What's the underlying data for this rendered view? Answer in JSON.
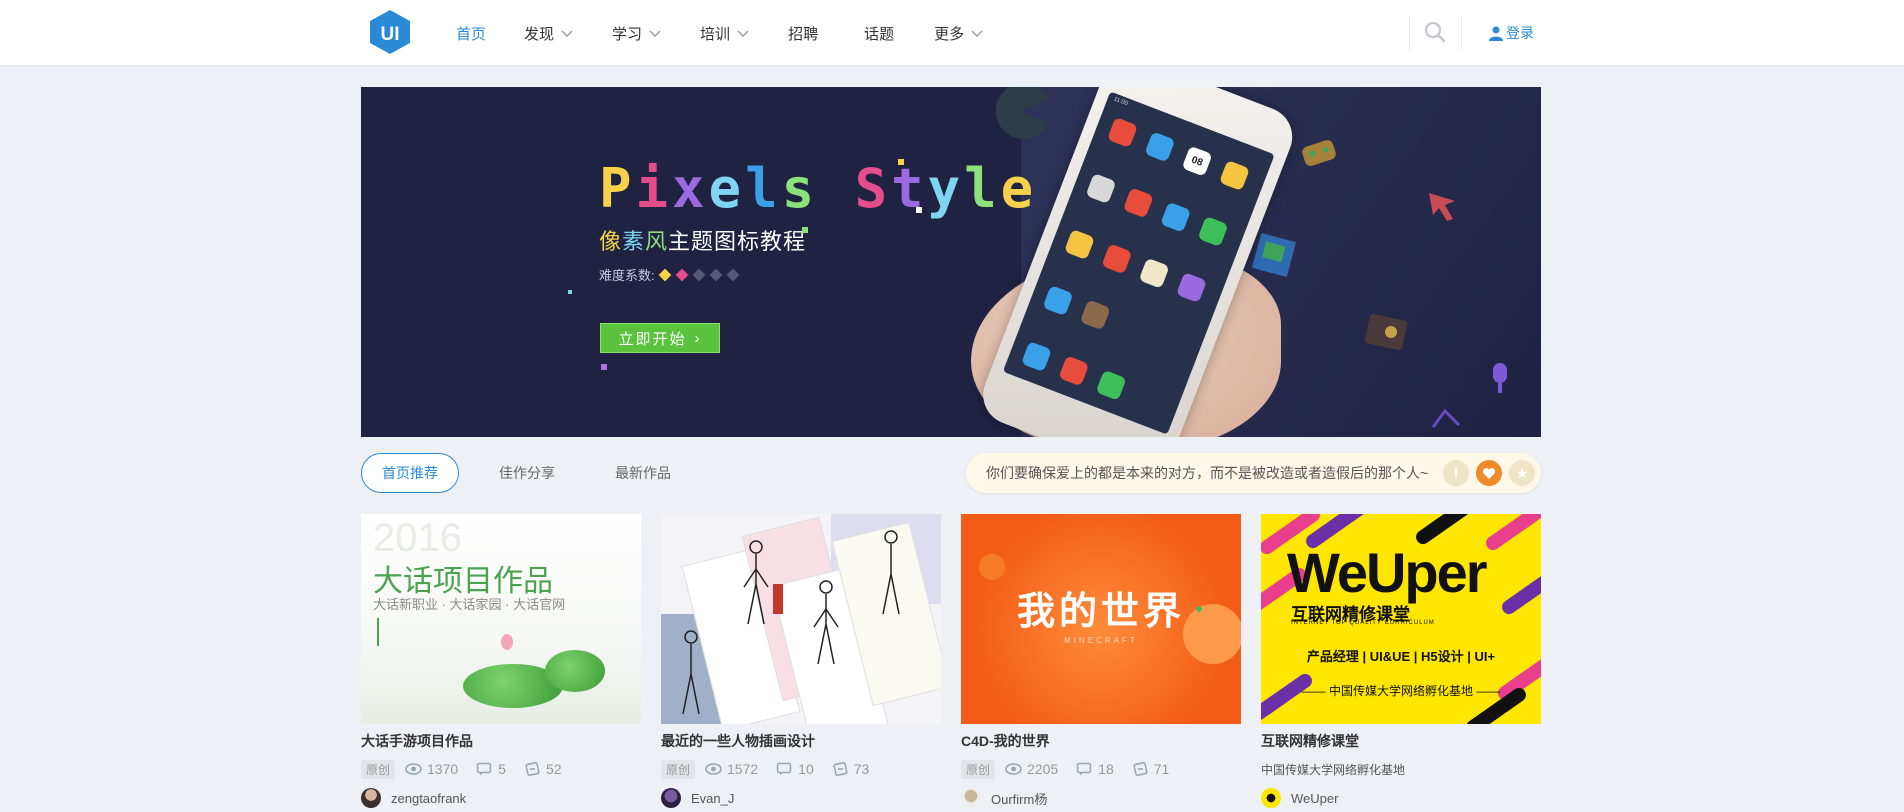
{
  "header": {
    "logo_text": "UI",
    "nav": [
      {
        "label": "首页",
        "active": true,
        "dropdown": false
      },
      {
        "label": "发现",
        "active": false,
        "dropdown": true
      },
      {
        "label": "学习",
        "active": false,
        "dropdown": true
      },
      {
        "label": "培训",
        "active": false,
        "dropdown": true
      },
      {
        "label": "招聘",
        "active": false,
        "dropdown": false
      },
      {
        "label": "话题",
        "active": false,
        "dropdown": false
      },
      {
        "label": "更多",
        "active": false,
        "dropdown": true
      }
    ],
    "search_icon": "search-icon",
    "login_label": "登录"
  },
  "banner": {
    "title": "Pixels Style",
    "subtitle_parts": [
      "像",
      "素",
      "风",
      "主题图标教程"
    ],
    "difficulty_label": "难度系数:",
    "difficulty_filled": 2,
    "difficulty_total": 5,
    "cta_label": "立即开始",
    "phone_time": "11:00",
    "phone_apps": [
      "Calculator",
      "File Management",
      "Calendar",
      "Email",
      "Tools",
      "Download",
      "Video",
      "Security Center",
      "Game",
      "Recording",
      "Map",
      "Radio",
      "Dial",
      "Contacts",
      "Message"
    ],
    "calendar_day": "08"
  },
  "tabs": [
    {
      "label": "首页推荐",
      "active": true
    },
    {
      "label": "佳作分享",
      "active": false
    },
    {
      "label": "最新作品",
      "active": false
    }
  ],
  "notice": {
    "text": "你们要确保爱上的都是本来的对方，而不是被改造或者造假后的那个人~",
    "icons": [
      "alert-icon",
      "heart-icon",
      "star-icon"
    ]
  },
  "cards": [
    {
      "title": "大话手游项目作品",
      "badge": "原创",
      "views": "1370",
      "comments": "5",
      "likes": "52",
      "author": "zengtaofrank",
      "thumb": {
        "year": "2016",
        "big": "大话项目作品",
        "small": "大话新职业 · 大话家园 · 大话官网"
      }
    },
    {
      "title": "最近的一些人物插画设计",
      "badge": "原创",
      "views": "1572",
      "comments": "10",
      "likes": "73",
      "author": "Evan_J",
      "thumb": {}
    },
    {
      "title": "C4D-我的世界",
      "badge": "原创",
      "views": "2205",
      "comments": "18",
      "likes": "71",
      "author": "Ourfirm杨",
      "thumb": {
        "big": "我的世界",
        "small": "MINECRAFT"
      }
    },
    {
      "title": "互联网精修课堂",
      "description": "中国传媒大学网络孵化基地",
      "author": "WeUper",
      "thumb": {
        "brand": "WeUper",
        "line1": "互联网精修课堂",
        "line2": "INTERNET TOP QUALITY CURRICULUM",
        "line3": "产品经理 | UI&UE | H5设计 | UI+",
        "line4": "—— 中国传媒大学网络孵化基地 ——"
      }
    }
  ],
  "colors": {
    "accent": "#2b8ad6",
    "banner_bg": "#1f2241",
    "cta_green": "#5ac23c",
    "page_bg": "#edf1f5"
  }
}
